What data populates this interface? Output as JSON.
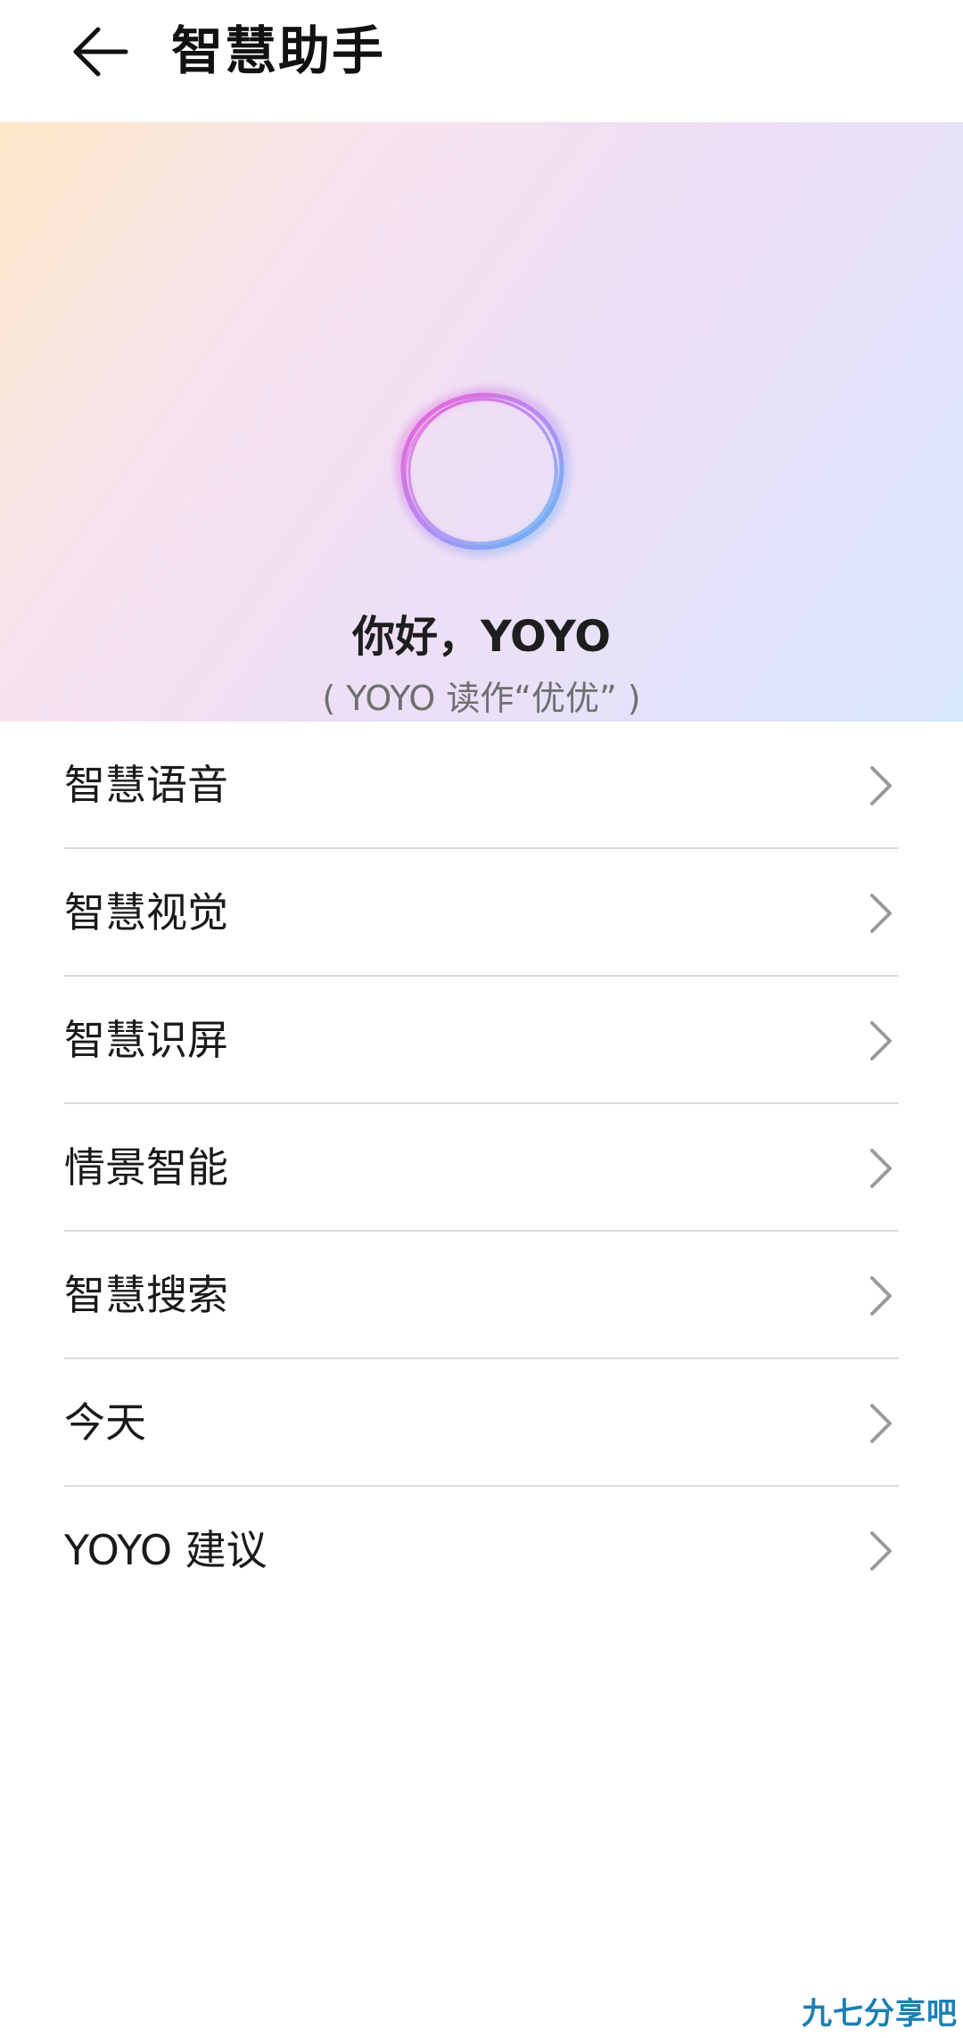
{
  "header": {
    "title": "智慧助手",
    "back_icon": "arrow-left-icon"
  },
  "banner": {
    "greeting": "你好，YOYO",
    "subtitle": "( YOYO 读作“优优” )",
    "orb_icon": "yoyo-orb-icon"
  },
  "menu": {
    "items": [
      {
        "label": "智慧语音"
      },
      {
        "label": "智慧视觉"
      },
      {
        "label": "智慧识屏"
      },
      {
        "label": "情景智能"
      },
      {
        "label": "智慧搜索"
      },
      {
        "label": "今天"
      },
      {
        "label": "YOYO 建议"
      }
    ],
    "chevron_icon": "chevron-right-icon"
  },
  "watermark": "九七分享吧",
  "colors": {
    "background": "#ffffff",
    "banner_gradient_start": "#fde9c7",
    "banner_gradient_end": "#d9e8fd",
    "orb_pink": "#ee5ad6",
    "orb_blue": "#56b5f5",
    "divider": "#dcdcdc",
    "chevron": "#9a9a9a",
    "watermark": "#1b7fb3"
  }
}
